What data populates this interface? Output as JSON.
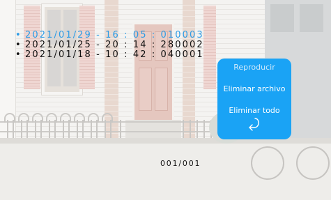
{
  "records": [
    {
      "bullet": "•",
      "text": "2021/01/29 - 16 : 05 : 010003",
      "selected": true
    },
    {
      "bullet": "•",
      "text": "2021/01/25 - 20 : 14 : 280002",
      "selected": false
    },
    {
      "bullet": "•",
      "text": "2021/01/18 - 10 : 42 : 040001",
      "selected": false
    }
  ],
  "menu": {
    "play_label": "Reproducir",
    "delete_file_label": "Eliminar archivo",
    "delete_all_label": "Eliminar todo",
    "back_icon": "return-arrow-icon"
  },
  "pagination": {
    "counter": "001/001"
  },
  "colors": {
    "selected_record": "#2b9be6",
    "menu_background": "#1aa3f5",
    "menu_text": "#ffffff",
    "active_menu_item": "#cfe9fb",
    "normal_text": "#111111"
  }
}
